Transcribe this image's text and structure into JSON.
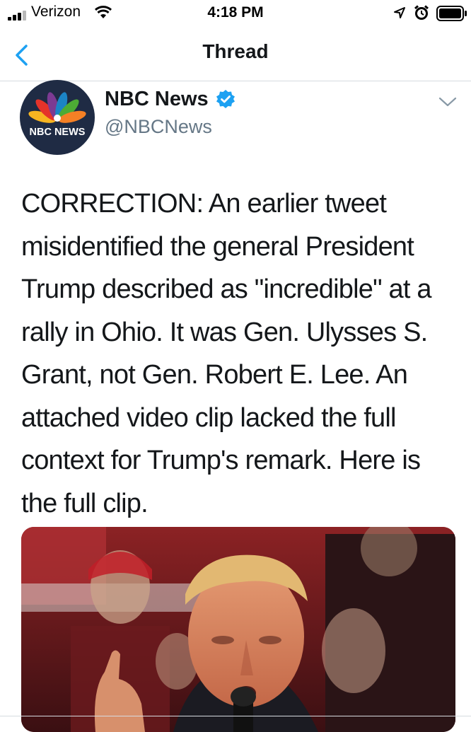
{
  "status_bar": {
    "carrier": "Verizon",
    "time": "4:18 PM"
  },
  "nav": {
    "title": "Thread"
  },
  "tweet": {
    "author_name": "NBC News",
    "handle": "@NBCNews",
    "avatar_label": "NBC NEWS",
    "text": "CORRECTION: An earlier tweet misidentified the general President Trump described as \"incredible\" at a rally in Ohio. It was Gen. Ulysses S. Grant, not Gen. Robert E. Lee. An attached video clip lacked the full context for Trump's remark. Here is the full clip."
  },
  "colors": {
    "accent": "#1da1f2",
    "avatar_bg": "#1f2b44",
    "secondary_text": "#657786"
  }
}
